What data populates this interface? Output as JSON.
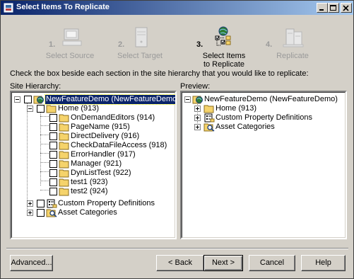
{
  "window": {
    "title": "Select Items To Replicate"
  },
  "steps": [
    {
      "num": "1.",
      "label": "Select Source",
      "active": false
    },
    {
      "num": "2.",
      "label": "Select Target",
      "active": false
    },
    {
      "num": "3.",
      "label": "Select Items to Replicate",
      "label_line1": "Select Items",
      "label_line2": "to Replicate",
      "active": true
    },
    {
      "num": "4.",
      "label": "Replicate",
      "active": false
    }
  ],
  "instructions": "Check the box beside each section in the site hierarchy that you would like to replicate:",
  "site_hierarchy": {
    "label": "Site Hierarchy:",
    "root": "NewFeatureDemo (NewFeatureDemo)",
    "home": "Home (913)",
    "pages": [
      "OnDemandEditors (914)",
      "PageName (915)",
      "DirectDelivery (916)",
      "CheckDataFileAccess (918)",
      "ErrorHandler (917)",
      "Manager (921)",
      "DynListTest (922)",
      "test1 (923)",
      "test2 (924)"
    ],
    "custom_props": "Custom Property Definitions",
    "asset_categories": "Asset Categories"
  },
  "preview": {
    "label": "Preview:",
    "root": "NewFeatureDemo (NewFeatureDemo)",
    "home": "Home (913)",
    "custom_props": "Custom Property Definitions",
    "asset_categories": "Asset Categories"
  },
  "buttons": {
    "advanced": "Advanced...",
    "back": "< Back",
    "next": "Next >",
    "cancel": "Cancel",
    "help": "Help"
  },
  "colors": {
    "titlebar_start": "#0a246a",
    "titlebar_end": "#a6caf0",
    "face": "#d4d0c8",
    "selection": "#0a246a",
    "folder": "#f5d36b"
  }
}
